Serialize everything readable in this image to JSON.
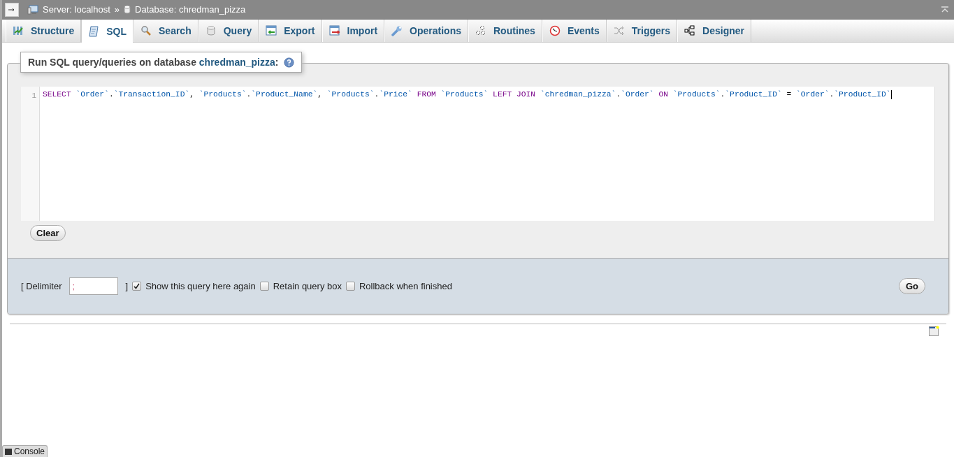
{
  "breadcrumb": {
    "server": "Server: localhost",
    "separator": "»",
    "database": "Database: chredman_pizza"
  },
  "tabs": [
    {
      "label": "Structure",
      "kind": "structure",
      "selected": false
    },
    {
      "label": "SQL",
      "kind": "sql",
      "selected": true
    },
    {
      "label": "Search",
      "kind": "search",
      "selected": false
    },
    {
      "label": "Query",
      "kind": "query",
      "selected": false
    },
    {
      "label": "Export",
      "kind": "export",
      "selected": false
    },
    {
      "label": "Import",
      "kind": "import",
      "selected": false
    },
    {
      "label": "Operations",
      "kind": "operations",
      "selected": false
    },
    {
      "label": "Routines",
      "kind": "routines",
      "selected": false
    },
    {
      "label": "Events",
      "kind": "events",
      "selected": false
    },
    {
      "label": "Triggers",
      "kind": "triggers",
      "selected": false
    },
    {
      "label": "Designer",
      "kind": "designer",
      "selected": false
    }
  ],
  "query_panel": {
    "legend": "Run SQL query/queries on database **chredman_pizza**:",
    "editor": {
      "line_number": "1",
      "tokens": [
        {
          "text": "SELECT ",
          "kind": "keyword"
        },
        {
          "text": "`Order`",
          "kind": "name"
        },
        {
          "text": ".",
          "kind": "plain"
        },
        {
          "text": "`Transaction_ID`",
          "kind": "name"
        },
        {
          "text": ", ",
          "kind": "plain"
        },
        {
          "text": "`Products`",
          "kind": "name"
        },
        {
          "text": ".",
          "kind": "plain"
        },
        {
          "text": "`Product_Name`",
          "kind": "name"
        },
        {
          "text": ", ",
          "kind": "plain"
        },
        {
          "text": "`Products`",
          "kind": "name"
        },
        {
          "text": ".",
          "kind": "plain"
        },
        {
          "text": "`Price`",
          "kind": "name"
        },
        {
          "text": " FROM ",
          "kind": "keyword"
        },
        {
          "text": "`Products`",
          "kind": "name"
        },
        {
          "text": " LEFT JOIN ",
          "kind": "keyword"
        },
        {
          "text": "`chredman_pizza`",
          "kind": "name"
        },
        {
          "text": ".",
          "kind": "plain"
        },
        {
          "text": "`Order`",
          "kind": "name"
        },
        {
          "text": " ON ",
          "kind": "keyword"
        },
        {
          "text": "`Products`",
          "kind": "name"
        },
        {
          "text": ".",
          "kind": "plain"
        },
        {
          "text": "`Product_ID`",
          "kind": "name"
        },
        {
          "text": " = ",
          "kind": "plain"
        },
        {
          "text": "`Order`",
          "kind": "name"
        },
        {
          "text": ".",
          "kind": "plain"
        },
        {
          "text": "`Product_ID`",
          "kind": "name"
        }
      ]
    },
    "clear_button": "Clear"
  },
  "options": {
    "delimiter_open": "[ Delimiter",
    "delimiter_value": ";",
    "delimiter_close": "]",
    "checkboxes": [
      {
        "label": "Show this query here again",
        "checked": true
      },
      {
        "label": "Retain query box",
        "checked": false
      },
      {
        "label": "Rollback when finished",
        "checked": false
      }
    ],
    "go_button": "Go"
  },
  "console": {
    "label": "Console"
  }
}
